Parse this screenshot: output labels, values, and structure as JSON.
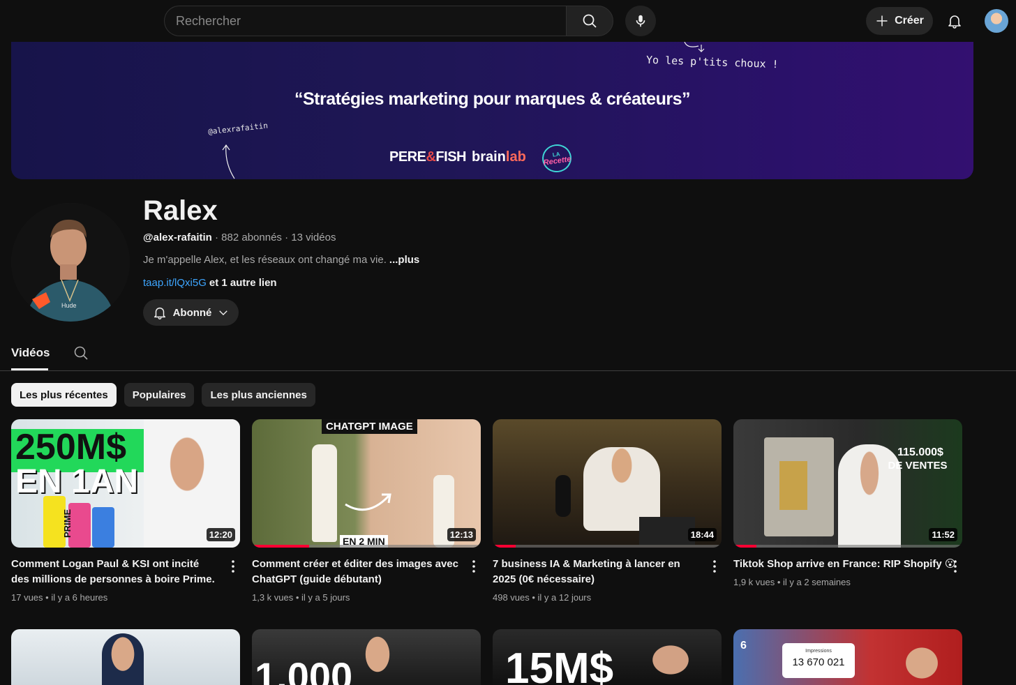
{
  "topbar": {
    "search_placeholder": "Rechercher",
    "create_label": "Créer"
  },
  "banner": {
    "tagline": "Yo les p'tits choux !",
    "headline": "“Stratégies marketing pour marques & créateurs”",
    "handle": "@alexrafaitin",
    "logo_pere_part1": "PERE",
    "logo_pere_amp": "&",
    "logo_pere_part2": "FISH",
    "logo_brain_part1": "brain",
    "logo_brain_part2": "lab",
    "logo_recette": "Recette",
    "logo_recette_la": "LA"
  },
  "channel": {
    "name": "Ralex",
    "handle": "@alex-rafaitin",
    "stats": " · 882 abonnés · 13 vidéos",
    "description": "Je m'appelle Alex, et les réseaux ont changé ma vie.",
    "more": "...plus",
    "link": "taap.it/lQxi5G",
    "other_links": "et 1 autre lien",
    "subscribe_label": "Abonné"
  },
  "tabs": {
    "videos": "Vidéos"
  },
  "chips": [
    "Les plus récentes",
    "Populaires",
    "Les plus anciennes"
  ],
  "videos": [
    {
      "title": "Comment Logan Paul & KSI ont incité des millions de personnes à boire Prime.",
      "views": "17 vues",
      "age": "il y a 6 heures",
      "duration": "12:20",
      "thumb_text_1": "250M$",
      "thumb_text_2": "EN 1AN",
      "thumb_text_3": "PRIME",
      "progress": 0
    },
    {
      "title": "Comment créer et éditer des images avec ChatGPT (guide débutant)",
      "views": "1,3 k vues",
      "age": "il y a 5 jours",
      "duration": "12:13",
      "thumb_text_1": "CHATGPT IMAGE",
      "thumb_text_2": "EN 2 MIN",
      "progress": 0.25
    },
    {
      "title": "7 business IA & Marketing à lancer en 2025 (0€ nécessaire)",
      "views": "498 vues",
      "age": "il y a 12 jours",
      "duration": "18:44",
      "progress": 0.1
    },
    {
      "title": "Tiktok Shop arrive en France: RIP Shopify 😮",
      "views": "1,9 k vues",
      "age": "il y a 2 semaines",
      "duration": "11:52",
      "thumb_text_1": "115.000$",
      "thumb_text_2": "DE VENTES",
      "progress": 0.1
    }
  ],
  "row2": [
    {
      "thumb_text": ""
    },
    {
      "thumb_text": "1.000"
    },
    {
      "thumb_text": "15M$"
    },
    {
      "thumb_text": "13 670 021",
      "thumb_label": "Impressions",
      "thumb_badge": "6"
    }
  ]
}
